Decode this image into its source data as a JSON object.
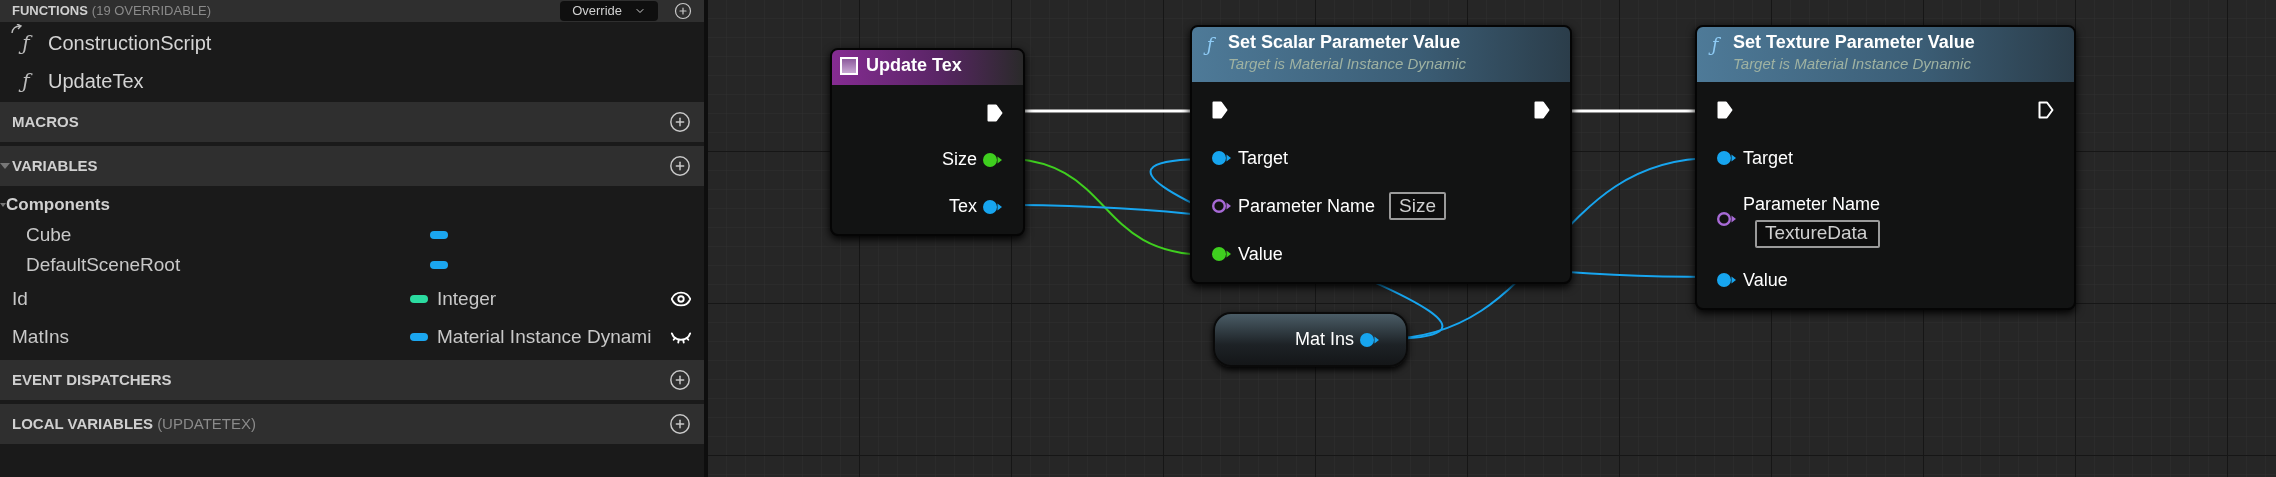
{
  "sidebar": {
    "header": {
      "title": "FUNCTIONS",
      "note": "(19 OVERRIDABLE)",
      "button": "Override"
    },
    "functions": [
      {
        "kind": "construction",
        "glyph": "ƒ",
        "label": "ConstructionScript"
      },
      {
        "kind": "function",
        "glyph": "ƒ",
        "label": "UpdateTex"
      }
    ],
    "macros": {
      "title": "MACROS"
    },
    "variables": {
      "title": "VARIABLES",
      "expanded": true,
      "categories": [
        {
          "label": "Components",
          "expanded": true,
          "items": [
            {
              "name": "Cube",
              "color": "#1ba6ef"
            },
            {
              "name": "DefaultSceneRoot",
              "color": "#1ba6ef"
            }
          ]
        }
      ],
      "items": [
        {
          "name": "Id",
          "color": "#2bdba0",
          "type": "Integer",
          "visible": true
        },
        {
          "name": "MatIns",
          "color": "#1ba6ef",
          "type": "Material Instance Dynami",
          "visible": false
        }
      ]
    },
    "event_dispatchers": {
      "title": "EVENT DISPATCHERS"
    },
    "local_variables": {
      "title": "LOCAL VARIABLES",
      "note": "(UPDATETEX)"
    }
  },
  "graph": {
    "nodes": [
      {
        "kind": "event",
        "title": "Update Tex",
        "outputs": [
          {
            "kind": "exec",
            "connected": true
          },
          {
            "kind": "data",
            "label": "Size",
            "color": "#3fcf1f",
            "connected": true
          },
          {
            "kind": "data",
            "label": "Tex",
            "color": "#17a5ef",
            "connected": true
          }
        ]
      },
      {
        "kind": "function",
        "glyph": "ƒ",
        "title": "Set Scalar Parameter Value",
        "subtitle": "Target is Material Instance Dynamic",
        "inputs": [
          {
            "kind": "exec",
            "connected": true
          },
          {
            "kind": "data",
            "label": "Target",
            "color": "#17a5ef",
            "connected": true
          },
          {
            "kind": "data",
            "label": "Parameter Name",
            "color": "#a76ad6",
            "connected": false,
            "value": "Size"
          },
          {
            "kind": "data",
            "label": "Value",
            "color": "#3fcf1f",
            "connected": true
          }
        ],
        "outputs": [
          {
            "kind": "exec",
            "connected": true
          }
        ]
      },
      {
        "kind": "variable",
        "title": "Mat Ins",
        "outputs": [
          {
            "kind": "data",
            "color": "#17a5ef",
            "connected": true
          }
        ]
      },
      {
        "kind": "function",
        "glyph": "ƒ",
        "title": "Set Texture Parameter Value",
        "subtitle": "Target is Material Instance Dynamic",
        "inputs": [
          {
            "kind": "exec",
            "connected": true
          },
          {
            "kind": "data",
            "label": "Target",
            "color": "#17a5ef",
            "connected": true
          },
          {
            "kind": "data",
            "label": "Parameter Name",
            "color": "#a76ad6",
            "connected": false,
            "value": "TextureData"
          },
          {
            "kind": "data",
            "label": "Value",
            "color": "#17a5ef",
            "connected": true
          }
        ],
        "outputs": [
          {
            "kind": "exec",
            "connected": false
          }
        ]
      }
    ]
  }
}
